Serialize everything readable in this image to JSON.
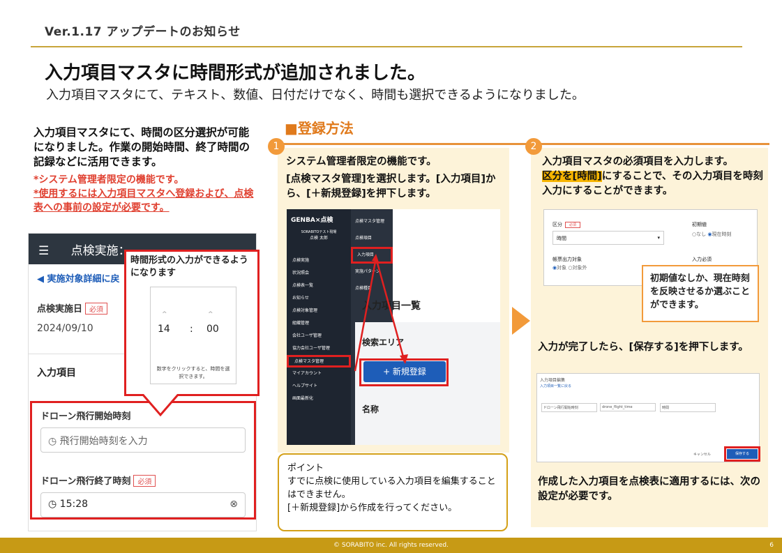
{
  "header": {
    "version": "Ver.1.17 アップデートのお知らせ"
  },
  "title": "入力項目マスタに時間形式が追加されました。",
  "subtitle": "入力項目マスタにて、テキスト、数値、日付だけでなく、時間も選択できるようになりました。",
  "intro": "入力項目マスタにて、時間の区分選択が可能になりました。作業の開始時間、終了時間の記録などに活用できます。",
  "note1": "*システム管理者限定の機能です。",
  "note2": "*使用するには入力項目マスタへ登録および、点検表への事前の設定が必要です。",
  "method_title": "■登録方法",
  "step1": {
    "num": "1",
    "line1": "システム管理者限定の機能です。",
    "line2": "[点検マスタ管理]を選択します。[入力項目]から、[＋新規登録]を押下します。"
  },
  "step2": {
    "num": "2",
    "line1": "入力項目マスタの必須項目を入力します。",
    "hl": "区分を[時間]",
    "line2": "にすることで、その入力項目を時刻入力にすることができます。"
  },
  "save_text": "入力が完了したら、[保存する]を押下します。",
  "apply_text": "作成した入力項目を点検表に適用するには、次の設定が必要です。",
  "point": {
    "title": "ポイント",
    "line1": "すでに点検に使用している入力項目を編集することはできません。",
    "line2": "[＋新規登録]から作成を行ってください。"
  },
  "phone": {
    "header": "点検実施：",
    "back": "実施対象詳細に戻",
    "date_label": "点検実施日",
    "required": "必須",
    "date_value": "2024/09/10",
    "section": "入力項目",
    "f1_label": "ドローン飛行開始時刻",
    "f1_placeholder": "飛行開始時刻を入力",
    "f2_label": "ドローン飛行終了時刻",
    "f2_value": "15:28"
  },
  "callout": {
    "text": "時間形式の入力ができるようになります",
    "hour": "14",
    "minute": "00",
    "sep": ":",
    "hint": "数字をクリックすると、時間を選択できます。"
  },
  "shot1": {
    "logo": "GENBA×点検",
    "company": "SORABITOテスト現場",
    "user": "点検 太郎",
    "menu": [
      "点検実施",
      "状況照会",
      "点検表一覧",
      "お知らせ",
      "点検対象管理",
      "組織管理",
      "会社ユーザ管理",
      "協力会社ユーザ管理",
      "点検マスタ管理",
      "マイアカウント",
      "ヘルプサイト",
      "画面最新化"
    ],
    "sub": [
      "点検マスタ管理",
      "点検項目",
      "入力項目",
      "実施パターン",
      "点検種目"
    ],
    "list_title": "入力項目一覧",
    "search": "検索エリア",
    "new": "+ 新規登録",
    "name": "名称"
  },
  "shot2": {
    "kubun": "区分",
    "required": "必須",
    "time": "時間",
    "initial": "初期値",
    "none": "なし",
    "now": "現在時刻",
    "report": "帳票出力対象",
    "target": "対象",
    "nontarget": "対象外",
    "input_req": "入力必須"
  },
  "tooltip2": "初期値なしか、現在時刻を反映させるか選ぶことができます。",
  "shot3": {
    "title": "入力項目編集",
    "back": "入力項目一覧に戻る",
    "name_val": "ドローン飛行開始時刻",
    "code_val": "drone_flight_time",
    "kubun_val": "時間",
    "cancel": "キャンセル",
    "save": "保存する"
  },
  "footer": "© SORABITO inc. All rights reserved.",
  "page": "6"
}
